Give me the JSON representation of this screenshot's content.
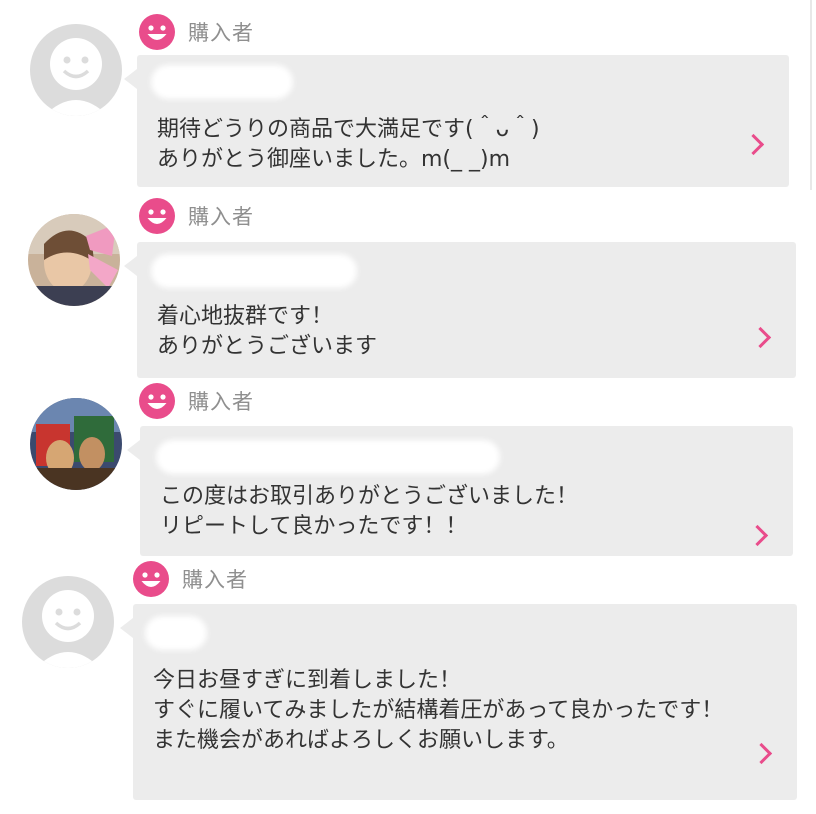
{
  "colors": {
    "accent": "#e94c8b",
    "bubble": "#ececec",
    "text": "#333333",
    "role_text": "#8f8f8f"
  },
  "reviews": [
    {
      "role": "購入者",
      "avatar": "default-face-icon",
      "message": "期待どうりの商品で大満足です(＾ᴗ＾)\nありがとう御座いました。m(_ _)m"
    },
    {
      "role": "購入者",
      "avatar": "user-photo",
      "message": "着心地抜群です！\nありがとうございます"
    },
    {
      "role": "購入者",
      "avatar": "user-photo",
      "message": "この度はお取引ありがとうございました！\nリピートして良かったです！！"
    },
    {
      "role": "購入者",
      "avatar": "default-face-icon",
      "message": "今日お昼すぎに到着しました！\nすぐに履いてみましたが結構着圧があって良かったです！\nまた機会があればよろしくお願いします。"
    }
  ]
}
